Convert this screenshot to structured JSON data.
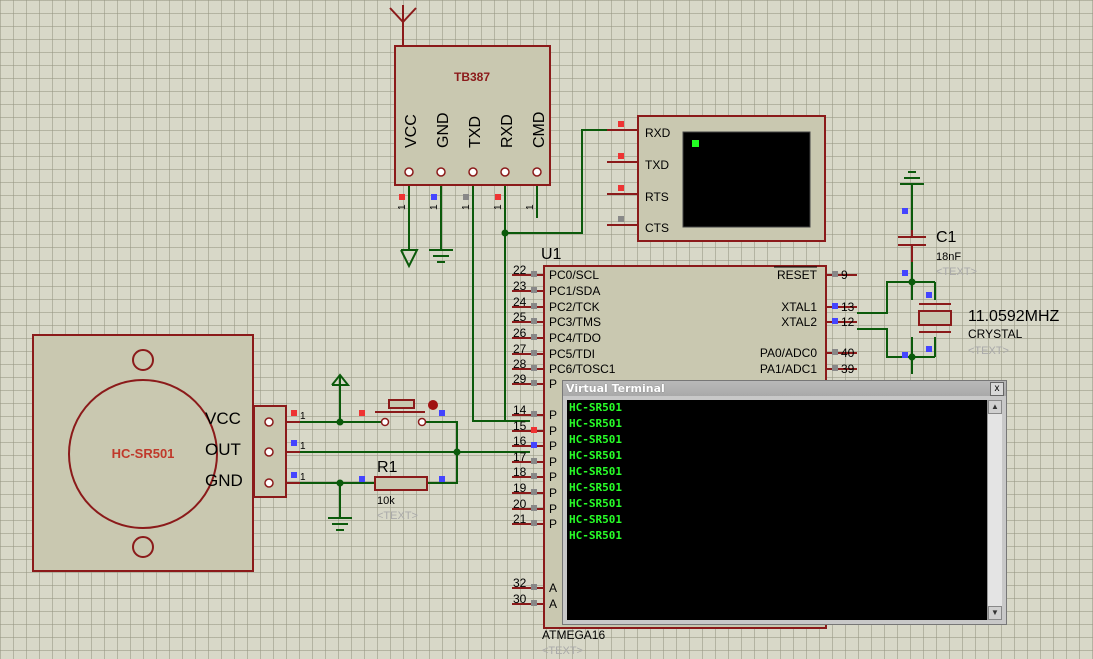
{
  "module": {
    "name": "TB387",
    "pins": [
      "VCC",
      "GND",
      "TXD",
      "RXD",
      "CMD"
    ],
    "pin_numbers": [
      "1",
      "1",
      "1",
      "1",
      "1"
    ]
  },
  "terminal_block": {
    "pins": [
      "RXD",
      "TXD",
      "RTS",
      "CTS"
    ]
  },
  "mcu": {
    "ref": "U1",
    "part": "ATMEGA16",
    "text_placeholder": "<TEXT>",
    "left_pins": [
      {
        "num": "22",
        "label": "PC0/SCL"
      },
      {
        "num": "23",
        "label": "PC1/SDA"
      },
      {
        "num": "24",
        "label": "PC2/TCK"
      },
      {
        "num": "25",
        "label": "PC3/TMS"
      },
      {
        "num": "26",
        "label": "PC4/TDO"
      },
      {
        "num": "27",
        "label": "PC5/TDI"
      },
      {
        "num": "28",
        "label": "PC6/TOSC1"
      },
      {
        "num": "29",
        "label": "P"
      },
      {
        "num": "14",
        "label": "P"
      },
      {
        "num": "15",
        "label": "P"
      },
      {
        "num": "16",
        "label": "P"
      },
      {
        "num": "17",
        "label": "P"
      },
      {
        "num": "18",
        "label": "P"
      },
      {
        "num": "19",
        "label": "P"
      },
      {
        "num": "20",
        "label": "P"
      },
      {
        "num": "21",
        "label": "P"
      },
      {
        "num": "32",
        "label": "A"
      },
      {
        "num": "30",
        "label": "A"
      }
    ],
    "right_pins": [
      {
        "num": "9",
        "label": "RESET"
      },
      {
        "num": "13",
        "label": "XTAL1"
      },
      {
        "num": "12",
        "label": "XTAL2"
      },
      {
        "num": "40",
        "label": "PA0/ADC0"
      },
      {
        "num": "39",
        "label": "PA1/ADC1"
      }
    ]
  },
  "capacitor": {
    "ref": "C1",
    "value": "18nF",
    "text": "<TEXT>"
  },
  "crystal": {
    "value": "11.0592MHZ",
    "part": "CRYSTAL",
    "text": "<TEXT>"
  },
  "resistor": {
    "ref": "R1",
    "value": "10k",
    "text": "<TEXT>"
  },
  "sensor": {
    "name": "HC-SR501",
    "pins": [
      "VCC",
      "OUT",
      "GND"
    ],
    "pin_numbers": [
      "1",
      "1",
      "1"
    ]
  },
  "virtual_terminal": {
    "title": "Virtual Terminal",
    "close": "x",
    "lines": [
      "HC-SR501",
      "HC-SR501",
      "HC-SR501",
      "HC-SR501",
      "HC-SR501",
      "HC-SR501",
      "HC-SR501",
      "HC-SR501",
      "HC-SR501"
    ]
  },
  "colors": {
    "component_border": "#8b1a1a",
    "component_fill": "#c9c8b0",
    "wire": "#0b5a0b",
    "terminal_text": "#28ff28"
  }
}
